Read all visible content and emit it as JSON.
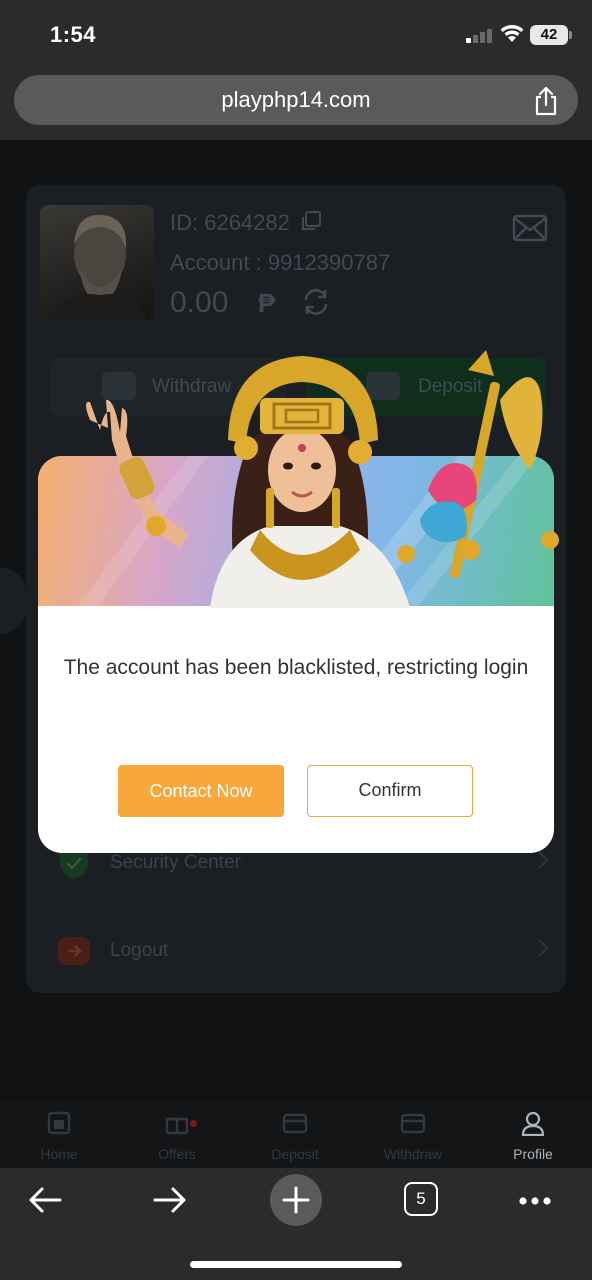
{
  "status_bar": {
    "time": "1:54",
    "battery": "42"
  },
  "browser": {
    "url": "playphp14.com",
    "tabs_count": "5"
  },
  "profile": {
    "id_label": "ID: 6264282",
    "account_label": "Account : 9912390787",
    "balance": "0.00",
    "currency_symbol": "₱"
  },
  "actions": {
    "withdraw": "Withdraw",
    "deposit": "Deposit"
  },
  "menu": [
    {
      "label": "Security Center"
    },
    {
      "label": "Logout"
    }
  ],
  "tabbar": [
    {
      "label": "Home"
    },
    {
      "label": "Offers"
    },
    {
      "label": "Deposit"
    },
    {
      "label": "Withdraw"
    },
    {
      "label": "Profile"
    }
  ],
  "modal": {
    "message": "The account has been blacklisted, restricting login",
    "contact_label": "Contact Now",
    "confirm_label": "Confirm"
  },
  "colors": {
    "accent_orange": "#f7a73c",
    "deposit_green": "#0f2e1b",
    "browser_chrome": "#2b2b2d"
  }
}
